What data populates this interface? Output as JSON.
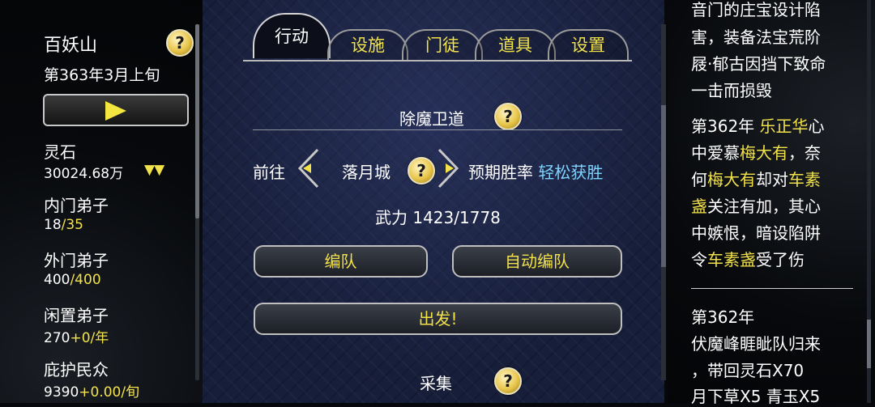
{
  "sidebar": {
    "sect_name": "百妖山",
    "date": "第363年3月上旬",
    "spirit_stone": {
      "label": "灵石",
      "value": "30024.68万",
      "trend": "▼▼"
    },
    "inner_disciples": {
      "label": "内门弟子",
      "current": "18",
      "max": "/35"
    },
    "outer_disciples": {
      "label": "外门弟子",
      "current": "400",
      "max": "/400"
    },
    "idle_disciples": {
      "label": "闲置弟子",
      "current": "270",
      "rate": "+0/年"
    },
    "protected_people": {
      "label": "庇护民众",
      "current": "9390",
      "rate": "+0.00/旬"
    },
    "help_label": "?"
  },
  "tabs": [
    {
      "label": "行动",
      "active": true
    },
    {
      "label": "设施",
      "active": false
    },
    {
      "label": "门徒",
      "active": false
    },
    {
      "label": "道具",
      "active": false
    },
    {
      "label": "设置",
      "active": false
    }
  ],
  "action_panel": {
    "section_title": "除魔卫道",
    "go_label": "前往",
    "destination": "落月城",
    "win_rate_label": "预期胜率",
    "win_rate_value": "轻松获胜",
    "force_label": "武力 1423/1778",
    "buttons": {
      "formation": "编队",
      "auto_formation": "自动编队",
      "depart": "出发!"
    },
    "next_section_title": "采集",
    "help_label": "?"
  },
  "log": {
    "lines_a": [
      "音门的庄宝设计陷",
      "害，装备法宝荒阶",
      "屐·郁古因挡下致命",
      "一击而损毁"
    ],
    "entry2": {
      "l1a": "第362年 ",
      "l1b": "乐正华",
      "l1c": "心",
      "l2a": "中爱慕",
      "l2b": "梅大有",
      "l2c": "，奈",
      "l3a": "何",
      "l3b": "梅大有",
      "l3c": "却对",
      "l3d": "车素",
      "l4a": "盏",
      "l4b": "关注有加，其心",
      "l5": "中嫉恨，暗设陷阱",
      "l6a": "令",
      "l6b": "车素盏",
      "l6c": "受了伤"
    },
    "entry3": {
      "l1": "第362年",
      "l2": "伏魔峰睚眦队归来",
      "l3": "，带回灵石X70",
      "l4": "月下草X5 青玉X5"
    }
  },
  "colors": {
    "highlight_yellow": "#f2e24a",
    "highlight_cyan": "#7fd4ff",
    "panel_navy": "#1a2240"
  }
}
